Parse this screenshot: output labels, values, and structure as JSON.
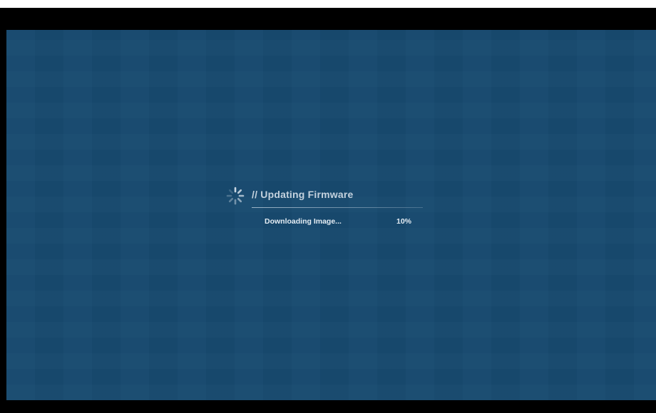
{
  "firmware_update": {
    "title": "// Updating Firmware",
    "status_text": "Downloading Image...",
    "progress_text": "10%",
    "progress_fraction": 0.1,
    "icon": "spinner-icon"
  },
  "colors": {
    "background": "#174a6f",
    "letterbox": "#000000",
    "text": "#e4ecf3",
    "title_text": "#c4d2de"
  }
}
